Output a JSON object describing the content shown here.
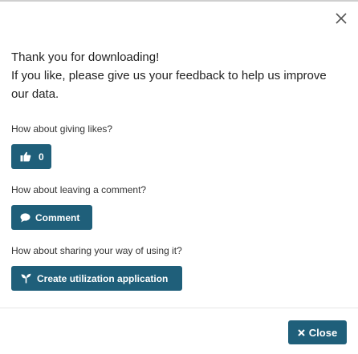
{
  "dialog": {
    "thanks_line1": "Thank you for downloading!",
    "thanks_line2": "If you like, please give us your feedback to help us improve our data."
  },
  "likes": {
    "question": "How about giving likes?",
    "count": "0",
    "icon": "thumbs-up-icon"
  },
  "comment": {
    "question": "How about leaving a comment?",
    "button_label": "Comment",
    "icon": "speech-bubble-icon"
  },
  "sharing": {
    "question": "How about sharing your way of using it?",
    "button_label": "Create utilization application",
    "icon": "plant-sprout-icon"
  },
  "footer": {
    "close_label": "Close",
    "close_icon": "close-icon"
  },
  "colors": {
    "button_bg": "#1f5f7a",
    "button_text": "#ffffff"
  }
}
